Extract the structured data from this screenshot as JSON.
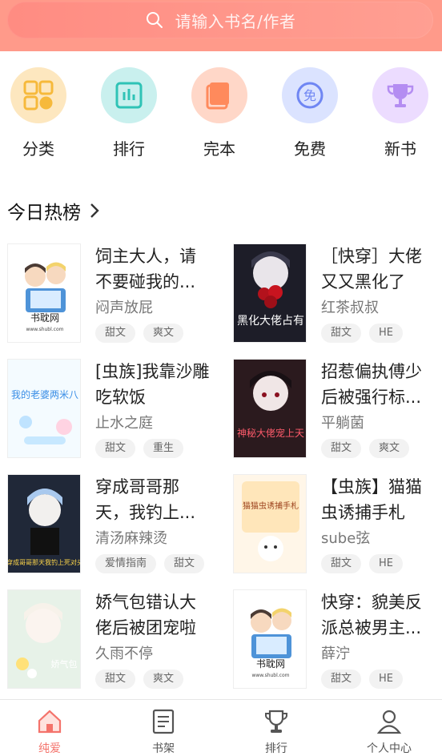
{
  "search": {
    "placeholder": "请输入书名/作者"
  },
  "categories": [
    {
      "label": "分类",
      "icon": "grid-icon",
      "bg": "#fde7bf"
    },
    {
      "label": "排行",
      "icon": "rank-chart-icon",
      "bg": "#c9f0ee"
    },
    {
      "label": "完本",
      "icon": "book-icon",
      "bg": "#ffd7c8"
    },
    {
      "label": "免费",
      "icon": "free-icon",
      "bg": "#dbe3ff"
    },
    {
      "label": "新书",
      "icon": "trophy-icon",
      "bg": "#ecdcff"
    }
  ],
  "section": {
    "title": "今日热榜"
  },
  "books": [
    {
      "title": "饲主大人，请不要碰我的...",
      "author": "闷声放屁",
      "tags": [
        "甜文",
        "爽文"
      ],
      "cover": "placeholder",
      "cover_text": "书耽网",
      "cover_sub": "www.shubl.com"
    },
    {
      "title": "［快穿］大佬又又黑化了",
      "author": "红茶叔叔",
      "tags": [
        "甜文",
        "HE"
      ],
      "cover": "dark",
      "cover_text": "黑化大佬占有"
    },
    {
      "title": "[虫族]我靠沙雕吃软饭",
      "author": "止水之庭",
      "tags": [
        "甜文",
        "重生"
      ],
      "cover": "light",
      "cover_text": "我的老婆两米八"
    },
    {
      "title": "招惹偏执傅少后被强行标...",
      "author": "平躺菌",
      "tags": [
        "甜文",
        "爽文"
      ],
      "cover": "gothic",
      "cover_text": "神秘大佬宠上天"
    },
    {
      "title": "穿成哥哥那天，我钓上...",
      "author": "清汤麻辣烫",
      "tags": [
        "爱情指南",
        "甜文"
      ],
      "cover": "boy",
      "cover_text": "穿成哥哥那天我钓上死对头"
    },
    {
      "title": "【虫族】猫猫虫诱捕手札",
      "author": "sube弦",
      "tags": [
        "甜文",
        "HE"
      ],
      "cover": "cat",
      "cover_text": "猫猫虫诱捕手札"
    },
    {
      "title": "娇气包错认大佬后被团宠啦",
      "author": "久雨不停",
      "tags": [
        "甜文",
        "爽文"
      ],
      "cover": "flower",
      "cover_text": "娇气包"
    },
    {
      "title": "快穿：貌美反派总被男主...",
      "author": "薛泞",
      "tags": [
        "甜文",
        "HE"
      ],
      "cover": "placeholder",
      "cover_text": "书耽网",
      "cover_sub": "www.shubl.com"
    }
  ],
  "tabs": [
    {
      "label": "纯爱",
      "icon": "home-icon",
      "active": true
    },
    {
      "label": "书架",
      "icon": "bookshelf-icon",
      "active": false
    },
    {
      "label": "排行",
      "icon": "ranking-trophy-icon",
      "active": false
    },
    {
      "label": "个人中心",
      "icon": "user-icon",
      "active": false
    }
  ],
  "colors": {
    "accent": "#f4736b",
    "header": "#ff9a8a"
  }
}
